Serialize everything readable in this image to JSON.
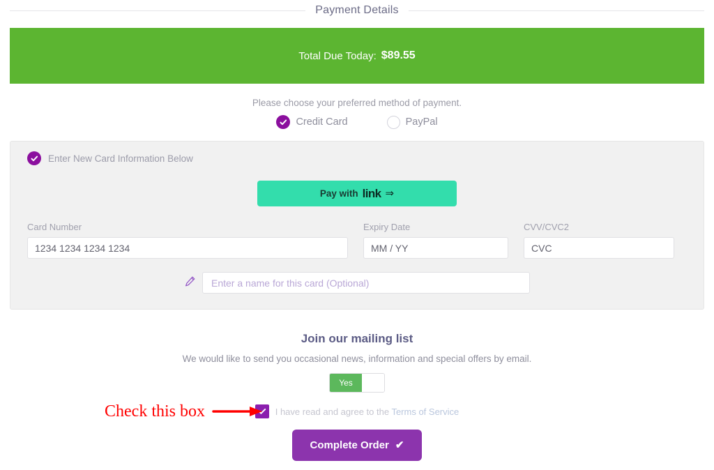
{
  "header": {
    "legend": "Payment Details"
  },
  "total": {
    "label": "Total Due Today:",
    "amount": "$89.55",
    "color": "#5cb531"
  },
  "method": {
    "prompt": "Please choose your preferred method of payment.",
    "options": [
      {
        "label": "Credit Card",
        "selected": true
      },
      {
        "label": "PayPal",
        "selected": false
      }
    ],
    "accent": "#8b0f9e"
  },
  "card_panel": {
    "heading": "Enter New Card Information Below",
    "link_button": {
      "prefix": "Pay with",
      "brand": "link",
      "arrow": "⇒",
      "color": "#33ddac"
    },
    "fields": [
      {
        "label": "Card Number",
        "placeholder": "1234 1234 1234 1234",
        "value": ""
      },
      {
        "label": "Expiry Date",
        "placeholder": "MM / YY",
        "value": ""
      },
      {
        "label": "CVV/CVC2",
        "placeholder": "CVC",
        "value": ""
      }
    ],
    "nickname": {
      "icon": "pencil-icon",
      "placeholder": "Enter a name for this card (Optional)",
      "value": ""
    }
  },
  "mailing": {
    "title": "Join our mailing list",
    "subtitle": "We would like to send you occasional news, information and special offers by email.",
    "toggle": {
      "on_label": "Yes",
      "state": "on",
      "color": "#5cb85c"
    }
  },
  "terms": {
    "annotation": "Check this box",
    "annotation_color": "#ff0000",
    "checkbox_checked": true,
    "text_before": "I have read and agree to the ",
    "link_text": "Terms of Service"
  },
  "complete": {
    "label": "Complete Order",
    "tick": "✔",
    "color": "#8c34ad"
  }
}
